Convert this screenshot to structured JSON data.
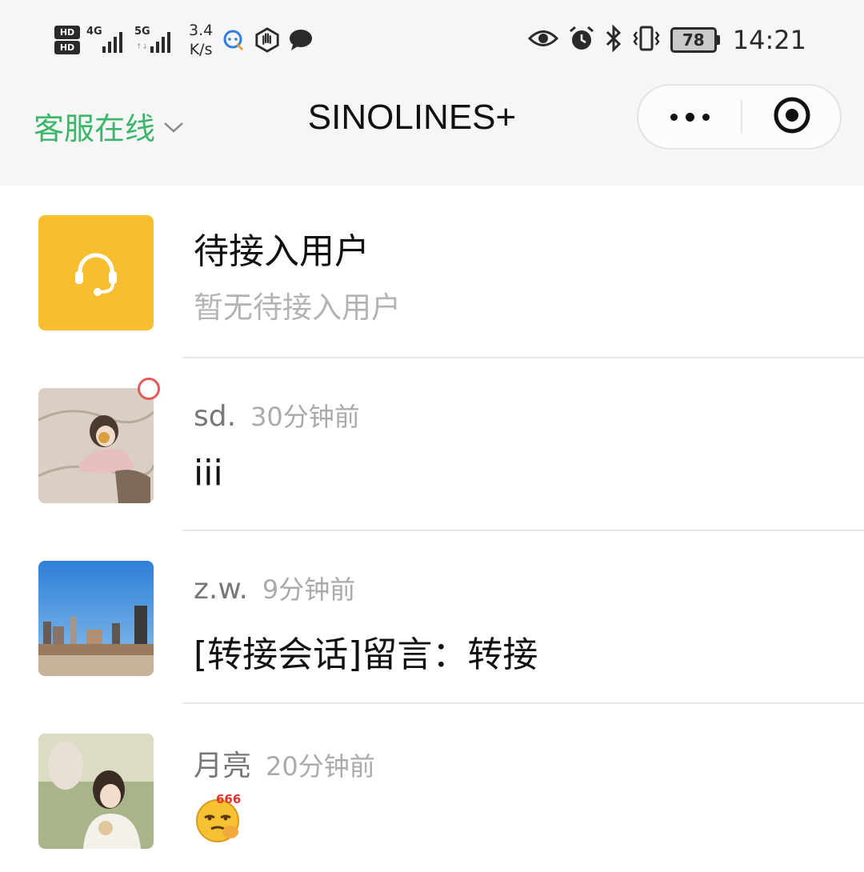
{
  "status_bar": {
    "hd1": "HD",
    "hd2": "HD",
    "net1": "4G",
    "net2": "5G",
    "speed_value": "3.4",
    "speed_unit": "K/s",
    "battery": "78",
    "time": "14:21",
    "icons": [
      "hd-icon",
      "signal-4g-icon",
      "signal-5g-icon",
      "chat-app-icon",
      "hand-stop-icon",
      "message-icon",
      "eye-icon",
      "alarm-icon",
      "bluetooth-icon",
      "vibrate-icon",
      "battery-icon"
    ]
  },
  "nav": {
    "service_status": "客服在线",
    "title": "SINOLINES+",
    "more_icon": "more-dots-icon",
    "close_icon": "target-close-icon"
  },
  "pending": {
    "title": "待接入用户",
    "subtitle": "暂无待接入用户",
    "icon": "headset-icon",
    "icon_bg": "#f7bf30"
  },
  "conversations": [
    {
      "name": "sd.",
      "time": "30分钟前",
      "message": "iii",
      "unread": true,
      "avatar": "avatar-girl-illustration"
    },
    {
      "name": "z.w.",
      "time": "9分钟前",
      "message": "[转接会话]留言：转接",
      "unread": false,
      "avatar": "avatar-city-river"
    },
    {
      "name": "月亮",
      "time": "20分钟前",
      "message": "",
      "emoji_label": "666",
      "emoji": "emoji-666-icon",
      "unread": false,
      "avatar": "avatar-couple-photo"
    }
  ],
  "colors": {
    "accent_green": "#3cb66a",
    "unread_red": "#e25b5b"
  }
}
